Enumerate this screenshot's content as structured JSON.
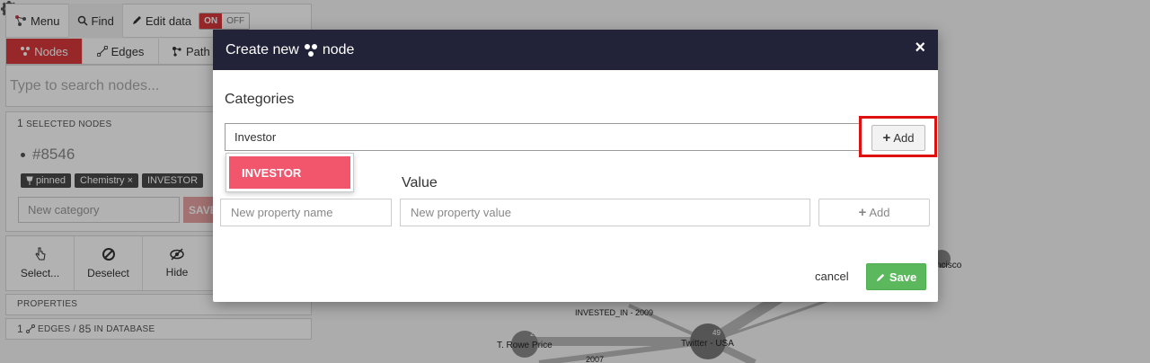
{
  "topbar": {
    "menu_label": "Menu",
    "find_label": "Find",
    "edit_label": "Edit data",
    "toggle_on": "ON",
    "toggle_off": "OFF"
  },
  "tabs": [
    {
      "label": "Nodes",
      "icon": "nodes-icon",
      "active": true
    },
    {
      "label": "Edges",
      "icon": "edge-icon",
      "active": false
    },
    {
      "label": "Path",
      "icon": "path-icon",
      "active": false
    }
  ],
  "search": {
    "placeholder": "Type to search nodes..."
  },
  "selection": {
    "count": "1",
    "label": "Selected nodes",
    "node_id": "#8546",
    "chips": [
      "pinned",
      "Chemistry",
      "INVESTOR"
    ],
    "new_category_placeholder": "New category",
    "save_label": "SAVE"
  },
  "actions": [
    {
      "label": "Select...",
      "icon": "hand-pointer-icon"
    },
    {
      "label": "Deselect",
      "icon": "ban-icon"
    },
    {
      "label": "Hide",
      "icon": "eye-slash-icon"
    }
  ],
  "properties_label": "Properties",
  "edges_info": {
    "count": "1",
    "label": "edges",
    "total": "85",
    "suffix": "in database"
  },
  "graph_labels": {
    "invested": "INVESTED_IN - 2009",
    "trowe": "T. Rowe Price",
    "trowe_badge": "29",
    "twitter": "Twitter - USA",
    "twitter_badge": "49",
    "francisco": "ncisco",
    "year2007": "2007"
  },
  "modal": {
    "title_prefix": "Create new",
    "title_suffix": "node",
    "close": "×",
    "categories_label": "Categories",
    "category_value": "Investor",
    "add_category_label": "Add",
    "suggestion": "INVESTOR",
    "value_label": "Value",
    "property_name_placeholder": "New property name",
    "property_value_placeholder": "New property value",
    "add_property_label": "Add",
    "cancel_label": "cancel",
    "save_label": "Save"
  },
  "colors": {
    "accent_red": "#d9383c",
    "modal_header": "#222238",
    "suggestion": "#f2566d",
    "save_green": "#5cb85c",
    "highlight": "#e01010"
  }
}
